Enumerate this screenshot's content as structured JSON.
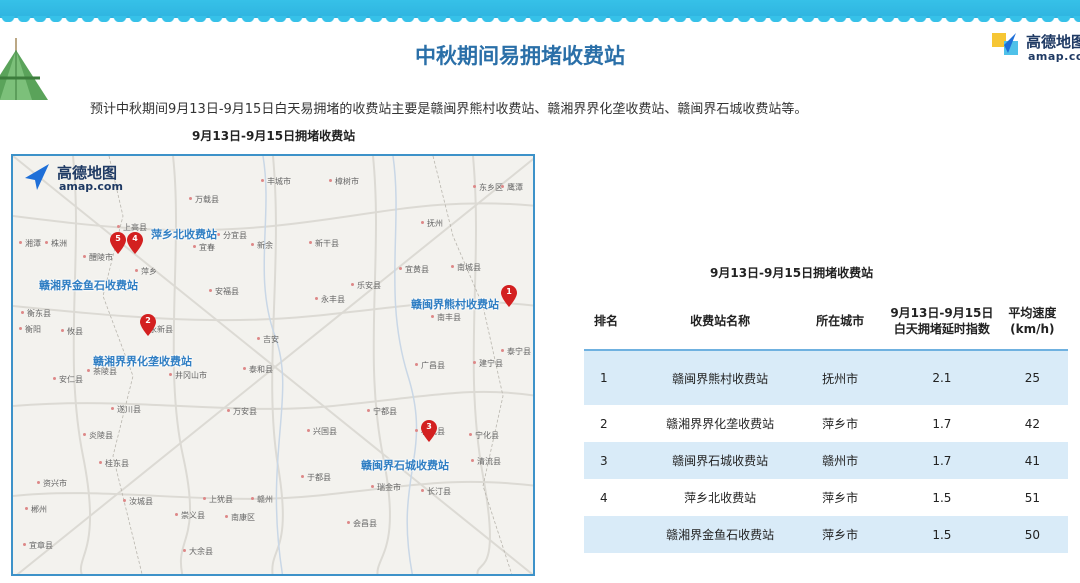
{
  "header": {
    "title": "中秋期间易拥堵收费站",
    "logo_brand": "高德地图",
    "logo_domain": "amap.com"
  },
  "intro": "预计中秋期间9月13日-9月15日白天易拥堵的收费站主要是赣闽界熊村收费站、赣湘界界化垄收费站、赣闽界石城收费站等。",
  "map": {
    "caption": "9月13日-9月15日拥堵收费站",
    "logo_brand": "高德地图",
    "logo_domain": "amap.com",
    "station_labels": {
      "s1": "赣闽界熊村收费站",
      "s2": "赣湘界界化垄收费站",
      "s3": "赣闽界石城收费站",
      "s4": "萍乡北收费站",
      "s5": "赣湘界金鱼石收费站"
    },
    "pins": [
      "1",
      "2",
      "3",
      "4",
      "5"
    ],
    "towns": [
      "万载县",
      "上高县",
      "分宜县",
      "新余",
      "宜春",
      "萍乡",
      "湘潭",
      "株洲",
      "醴陵市",
      "安福县",
      "吉安",
      "永新县",
      "泰和县",
      "井冈山市",
      "遂川县",
      "万安县",
      "赣州",
      "于都县",
      "兴国县",
      "宁都县",
      "瑞金市",
      "会昌县",
      "上犹县",
      "南康区",
      "大余县",
      "崇义县",
      "抚州",
      "宜黄县",
      "乐安县",
      "永丰县",
      "新干县",
      "南城县",
      "南丰县",
      "广昌县",
      "石城县",
      "宁化县",
      "建宁县",
      "泰宁县",
      "清流县",
      "长汀县",
      "茶陵县",
      "炎陵县",
      "安仁县",
      "资兴市",
      "郴州",
      "宜章县",
      "桂东县",
      "汝城县",
      "衡阳",
      "衡东县",
      "攸县",
      "樟树市",
      "丰城市",
      "东乡区",
      "鹰潭"
    ]
  },
  "table": {
    "caption": "9月13日-9月15日拥堵收费站",
    "headers": {
      "rank": "排名",
      "name": "收费站名称",
      "city": "所在城市",
      "index_line1": "9月13日-9月15日",
      "index_line2": "白天拥堵延时指数",
      "speed_line1": "平均速度",
      "speed_line2": "(km/h)"
    },
    "rows": [
      {
        "rank": "1",
        "name": "赣闽界熊村收费站",
        "city": "抚州市",
        "index": "2.1",
        "speed": "25"
      },
      {
        "rank": "2",
        "name": "赣湘界界化垄收费站",
        "city": "萍乡市",
        "index": "1.7",
        "speed": "42"
      },
      {
        "rank": "3",
        "name": "赣闽界石城收费站",
        "city": "赣州市",
        "index": "1.7",
        "speed": "41"
      },
      {
        "rank": "4",
        "name": "萍乡北收费站",
        "city": "萍乡市",
        "index": "1.5",
        "speed": "51"
      },
      {
        "rank": "",
        "name": "赣湘界金鱼石收费站",
        "city": "萍乡市",
        "index": "1.5",
        "speed": "50"
      }
    ]
  },
  "colors": {
    "title": "#2a6fa8",
    "band": "#36c1e8",
    "station_label": "#2f7ec3",
    "pin": "#d32020",
    "row_shade": "#d9ebf8",
    "table_rule": "#6fb1e0"
  }
}
